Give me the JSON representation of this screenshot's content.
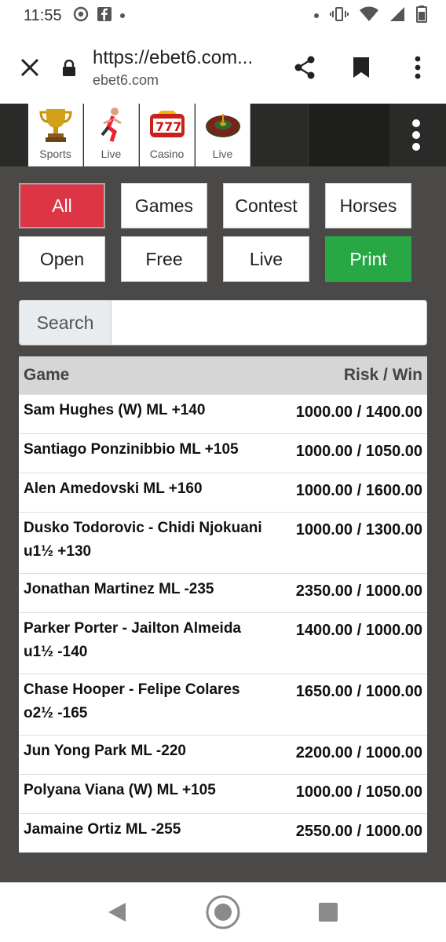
{
  "status_bar": {
    "time": "11:55"
  },
  "browser": {
    "url": "https://ebet6.com...",
    "domain": "ebet6.com"
  },
  "site_nav": {
    "tiles": [
      {
        "label": "Sports",
        "icon": "trophy-icon"
      },
      {
        "label": "Live",
        "icon": "runner-icon"
      },
      {
        "label": "Casino",
        "icon": "slot-machine-icon"
      },
      {
        "label": "Live",
        "icon": "roulette-icon"
      }
    ]
  },
  "filters": {
    "all": "All",
    "games": "Games",
    "contest": "Contest",
    "horses": "Horses",
    "open": "Open",
    "free": "Free",
    "live": "Live",
    "print": "Print"
  },
  "search": {
    "label": "Search",
    "value": ""
  },
  "table": {
    "headers": {
      "game": "Game",
      "risk_win": "Risk / Win"
    },
    "rows": [
      {
        "game": "Sam Hughes (W) ML +140",
        "risk_win": "1000.00 / 1400.00"
      },
      {
        "game": "Santiago Ponzinibbio ML +105",
        "risk_win": "1000.00 / 1050.00"
      },
      {
        "game": "Alen Amedovski ML +160",
        "risk_win": "1000.00 / 1600.00"
      },
      {
        "game": "Dusko Todorovic - Chidi Njokuani u1½ +130",
        "risk_win": "1000.00 / 1300.00"
      },
      {
        "game": "Jonathan Martinez ML -235",
        "risk_win": "2350.00 / 1000.00"
      },
      {
        "game": "Parker Porter - Jailton Almeida u1½ -140",
        "risk_win": "1400.00 / 1000.00"
      },
      {
        "game": "Chase Hooper - Felipe Colares o2½ -165",
        "risk_win": "1650.00 / 1000.00"
      },
      {
        "game": "Jun Yong Park ML -220",
        "risk_win": "2200.00 / 1000.00"
      },
      {
        "game": "Polyana Viana (W) ML +105",
        "risk_win": "1000.00 / 1050.00"
      },
      {
        "game": "Jamaine Ortiz ML -255",
        "risk_win": "2550.00 / 1000.00"
      }
    ]
  },
  "colors": {
    "active_filter": "#dc3545",
    "print_button": "#28a745",
    "content_bg": "#4a4948",
    "header_bg": "#2a2a28"
  }
}
